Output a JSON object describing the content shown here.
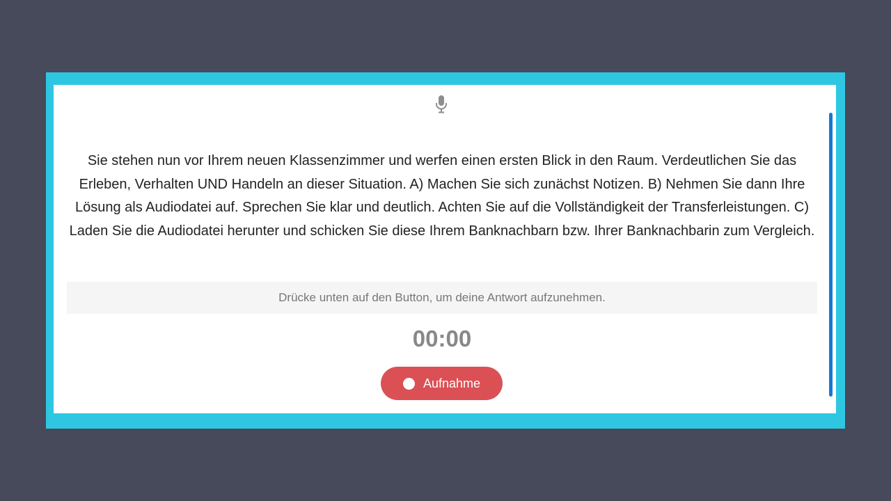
{
  "recorder": {
    "icon": "microphone-icon",
    "prompt": "Sie stehen nun vor Ihrem neuen Klassenzimmer und werfen einen ersten Blick in den Raum. Verdeutlichen Sie das Erleben, Verhalten UND Handeln an dieser Situation. A) Machen Sie sich zunächst Notizen. B) Nehmen Sie dann Ihre Lösung als Audiodatei auf. Sprechen Sie klar und deutlich. Achten Sie auf die Vollständigkeit der Transferleistungen. C) Laden Sie die Audiodatei herunter und schicken Sie diese Ihrem Banknachbarn bzw. Ihrer Banknachbarin zum Vergleich.",
    "hint": "Drücke unten auf den Button, um deine Antwort aufzunehmen.",
    "timer": "00:00",
    "record_button_label": "Aufnahme"
  },
  "colors": {
    "background": "#464a5a",
    "frame": "#2ec7e1",
    "record_button": "#db5055",
    "scrollbar": "#1679d1"
  }
}
